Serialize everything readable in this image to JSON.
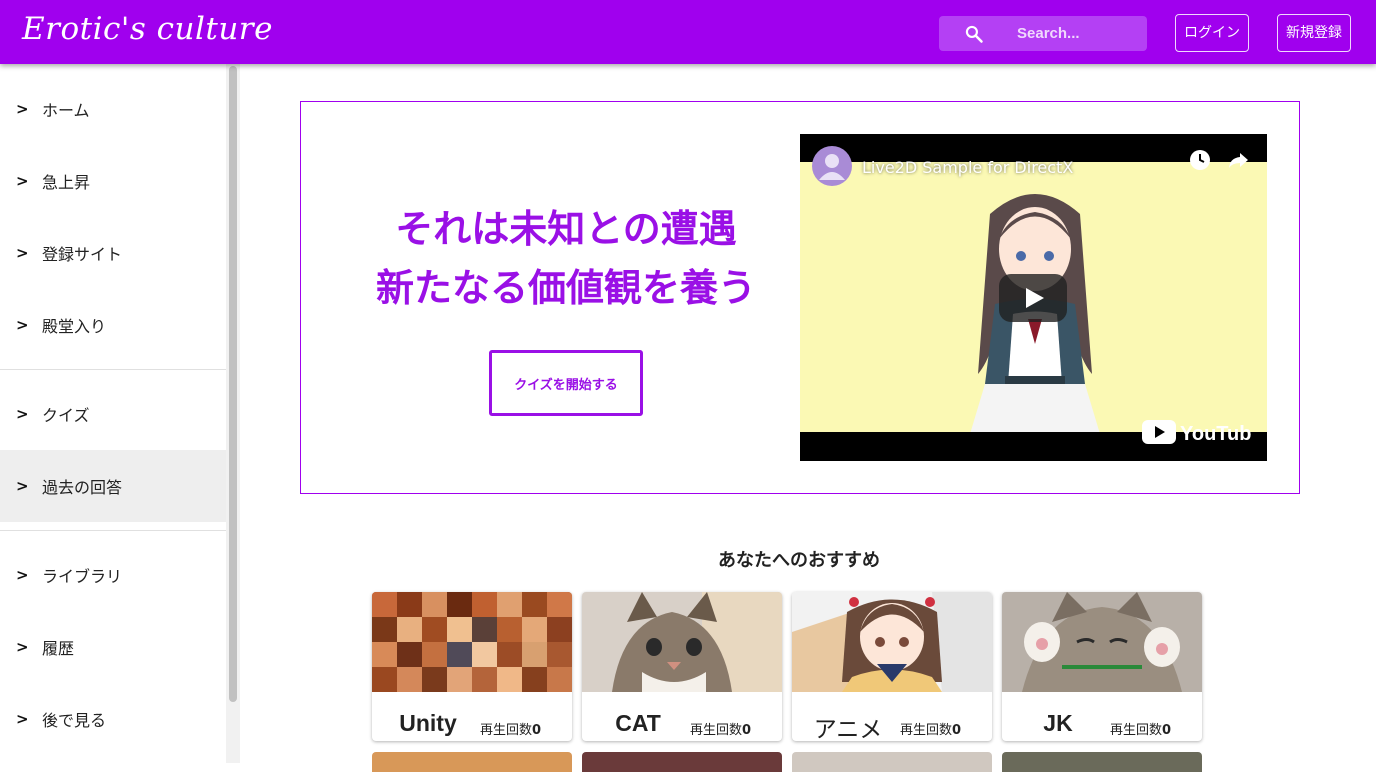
{
  "header": {
    "logo": "Erotic's culture",
    "search_placeholder": "Search...",
    "login_label": "ログイン",
    "register_label": "新規登録",
    "brand_color": "#a000ee"
  },
  "sidebar": {
    "arrow": ">",
    "items": [
      {
        "label": "ホーム"
      },
      {
        "label": "急上昇"
      },
      {
        "label": "登録サイト"
      },
      {
        "label": "殿堂入り"
      },
      {
        "label": "クイズ"
      },
      {
        "label": "過去の回答"
      },
      {
        "label": "ライブラリ"
      },
      {
        "label": "履歴"
      },
      {
        "label": "後で見る"
      }
    ],
    "active_item": "過去の回答"
  },
  "hero": {
    "tagline_line1": "それは未知との遭遇",
    "tagline_line2": "新たなる価値観を養う",
    "quiz_button": "クイズを開始する",
    "video": {
      "title": "Live2D Sample for DirectX",
      "provider": "YouTube"
    }
  },
  "recommendations": {
    "title": "あなたへのおすすめ",
    "plays_label": "再生回数",
    "cards": [
      {
        "name": "Unity",
        "plays": "0"
      },
      {
        "name": "CAT",
        "plays": "0"
      },
      {
        "name": "アニメ",
        "plays": "0"
      },
      {
        "name": "JK",
        "plays": "0"
      }
    ]
  }
}
